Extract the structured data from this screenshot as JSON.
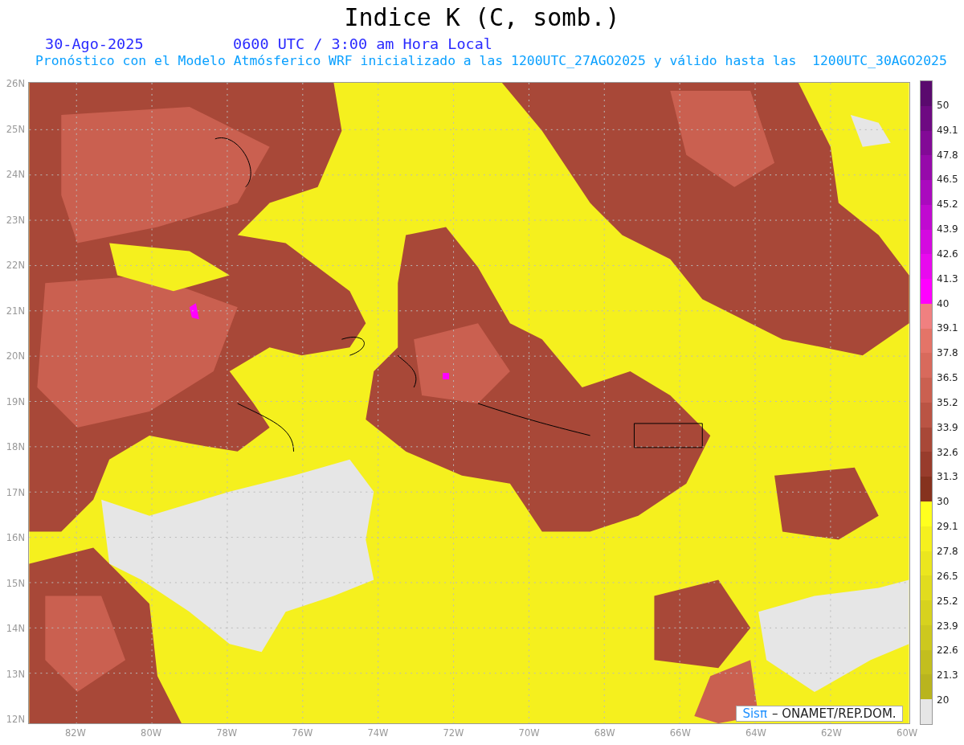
{
  "title": "Indice K (C, somb.)",
  "date": "30-Ago-2025",
  "time": "0600 UTC / 3:00 am Hora Local",
  "subtitle": "Pronóstico con el Modelo Atmósferico WRF inicializado a las 1200UTC_27AGO2025 y válido hasta las  1200UTC_30AGO2025",
  "y_axis": [
    "26N",
    "25N",
    "24N",
    "23N",
    "22N",
    "21N",
    "20N",
    "19N",
    "18N",
    "17N",
    "16N",
    "15N",
    "14N",
    "13N",
    "12N"
  ],
  "x_axis": [
    "82W",
    "80W",
    "78W",
    "76W",
    "74W",
    "72W",
    "70W",
    "68W",
    "66W",
    "64W",
    "62W",
    "60W"
  ],
  "colorbar": {
    "segments": [
      {
        "color": "#5a0a6e"
      },
      {
        "color": "#6e0a82"
      },
      {
        "color": "#820a96"
      },
      {
        "color": "#960aaa"
      },
      {
        "color": "#aa0abe"
      },
      {
        "color": "#c00ad0"
      },
      {
        "color": "#d40ae0"
      },
      {
        "color": "#e80aee"
      },
      {
        "color": "#ff00ff"
      },
      {
        "color": "#f08080"
      },
      {
        "color": "#e47468"
      },
      {
        "color": "#d86a5c"
      },
      {
        "color": "#ca6050"
      },
      {
        "color": "#ba5444"
      },
      {
        "color": "#a84838"
      },
      {
        "color": "#983c2c"
      },
      {
        "color": "#86321e"
      },
      {
        "color": "#ffff1e"
      },
      {
        "color": "#f5f01e"
      },
      {
        "color": "#ebe61e"
      },
      {
        "color": "#e1dc1e"
      },
      {
        "color": "#d7d21e"
      },
      {
        "color": "#cdc81e"
      },
      {
        "color": "#c3be1e"
      },
      {
        "color": "#b9b41e"
      },
      {
        "color": "#e6e6e6"
      }
    ],
    "labels": [
      "50",
      "49.1",
      "47.8",
      "46.5",
      "45.2",
      "43.9",
      "42.6",
      "41.3",
      "40",
      "39.1",
      "37.8",
      "36.5",
      "35.2",
      "33.9",
      "32.6",
      "31.3",
      "30",
      "29.1",
      "27.8",
      "26.5",
      "25.2",
      "23.9",
      "22.6",
      "21.3",
      "20"
    ]
  },
  "credit": {
    "brand": "Sisπ",
    "text": "– ONAMET/REP.DOM."
  }
}
